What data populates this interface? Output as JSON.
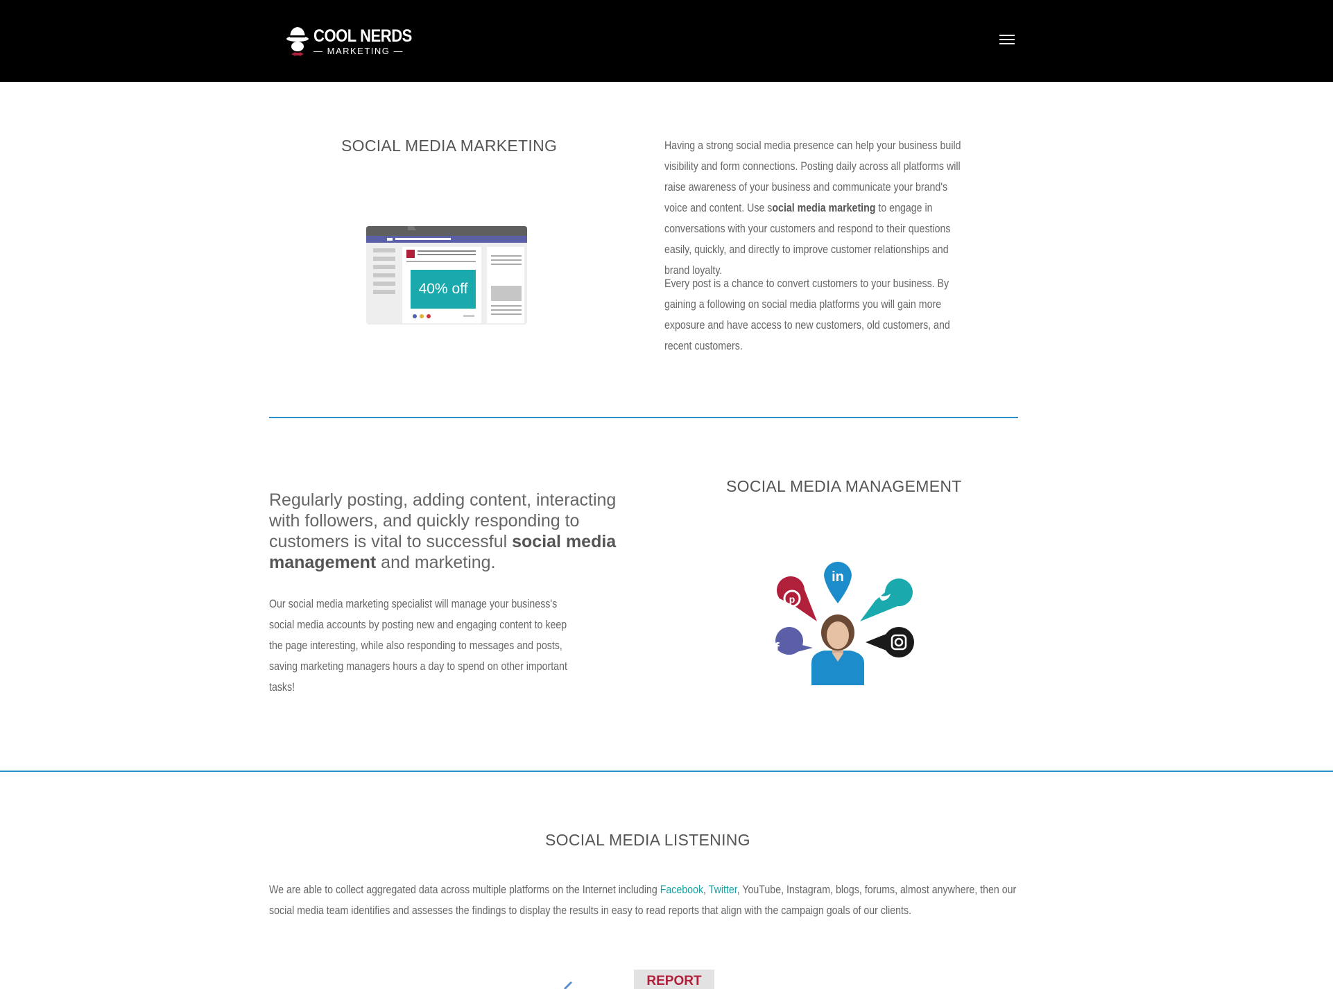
{
  "header": {
    "logo_title": "COOL NERDS",
    "logo_subtitle": "— MARKETING —",
    "menu_icon": "hamburger-menu-icon"
  },
  "section1": {
    "title": "SOCIAL MEDIA MARKETING",
    "ad_badge": "40% off",
    "p1_a": "Having a strong social media presence can help your business build visibility and form connections. Posting daily across all platforms will raise awareness of your business and communicate your brand's voice and content. Use s",
    "p1_bold": "ocial media marketing",
    "p1_b": " to engage in conversations with your customers and respond to their questions easily, quickly, and directly to improve customer relationships and brand loyalty.",
    "p2": "Every post is a chance to convert customers to your business. By gaining a following on social media platforms you will gain more exposure and have access to new customers, old customers, and recent customers."
  },
  "section2": {
    "title": "SOCIAL MEDIA MANAGEMENT",
    "lead_a": "Regularly posting, adding content, interacting with followers, and quickly responding to customers is vital to successful ",
    "lead_bold": "social media management",
    "lead_b": " and marketing.",
    "body": "Our social media marketing specialist will manage your business's social media accounts by posting new and engaging content to keep the page interesting, while also responding to messages and posts, saving marketing managers hours a day to spend on other important tasks!"
  },
  "section3": {
    "title": "SOCIAL MEDIA LISTENING",
    "text_a": "We are able to collect aggregated data across multiple platforms on the Internet including ",
    "link_facebook": "Facebook",
    "sep": ", ",
    "link_twitter": "Twitter",
    "text_b": ", YouTube, Instagram, blogs, forums, almost anywhere, then our social media team identifies and assesses the findings to display the results in easy to read reports that align with the campaign goals of our clients.",
    "report_label": "REPORT"
  },
  "colors": {
    "accent_rule": "#2a8fc9",
    "link": "#16a3a3",
    "ad_teal": "#1aa9ad",
    "nav_purple": "#5b5fa8"
  }
}
